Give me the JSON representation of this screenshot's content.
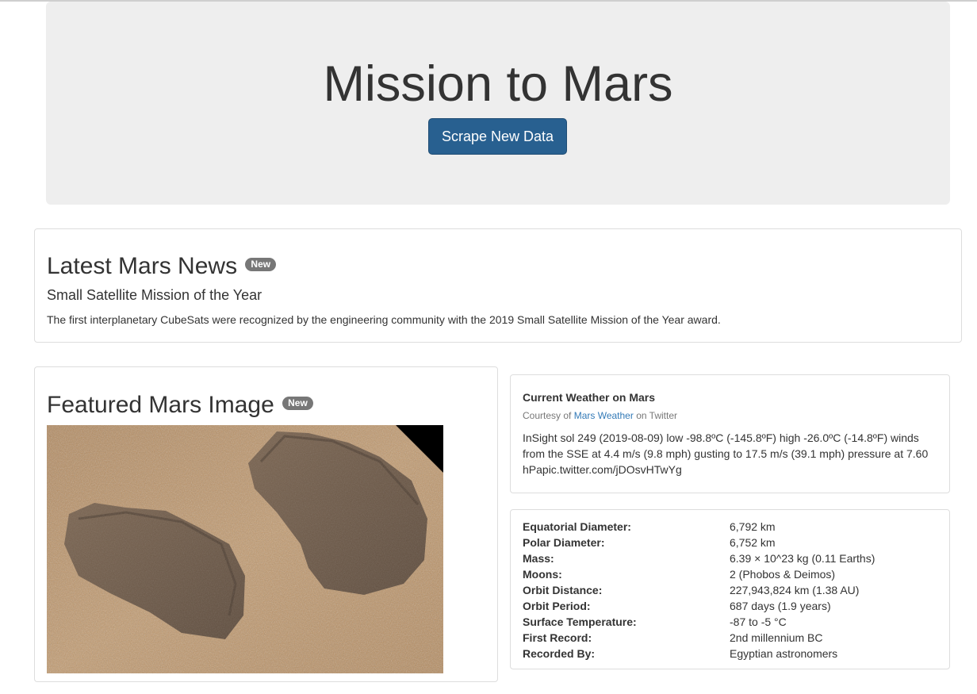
{
  "jumbotron": {
    "title": "Mission to Mars",
    "button_label": "Scrape New Data"
  },
  "news": {
    "section_title": "Latest Mars News",
    "badge": "New",
    "headline": "Small Satellite Mission of the Year",
    "teaser": "The first interplanetary CubeSats were recognized by the engineering community with the 2019 Small Satellite Mission of the Year award."
  },
  "featured_image": {
    "section_title": "Featured Mars Image",
    "badge": "New"
  },
  "weather": {
    "heading": "Current Weather on Mars",
    "credit_prefix": "Courtesy of",
    "credit_link": "Mars Weather",
    "credit_suffix": "on Twitter",
    "text": "InSight sol 249 (2019-08-09) low -98.8ºC (-145.8ºF) high -26.0ºC (-14.8ºF) winds from the SSE at 4.4 m/s (9.8 mph) gusting to 17.5 m/s (39.1 mph) pressure at 7.60 hPapic.twitter.com/jDOsvHTwYg"
  },
  "facts": [
    {
      "label": "Equatorial Diameter:",
      "value": "6,792 km"
    },
    {
      "label": "Polar Diameter:",
      "value": "6,752 km"
    },
    {
      "label": "Mass:",
      "value": "6.39 × 10^23 kg (0.11 Earths)"
    },
    {
      "label": "Moons:",
      "value": "2 (Phobos & Deimos)"
    },
    {
      "label": "Orbit Distance:",
      "value": "227,943,824 km (1.38 AU)"
    },
    {
      "label": "Orbit Period:",
      "value": "687 days (1.9 years)"
    },
    {
      "label": "Surface Temperature:",
      "value": "-87 to -5 °C"
    },
    {
      "label": "First Record:",
      "value": "2nd millennium BC"
    },
    {
      "label": "Recorded By:",
      "value": "Egyptian astronomers"
    }
  ],
  "colors": {
    "jumbotron_bg": "#eeeeee",
    "primary_button": "#286090",
    "badge": "#777777",
    "link": "#337ab7"
  }
}
